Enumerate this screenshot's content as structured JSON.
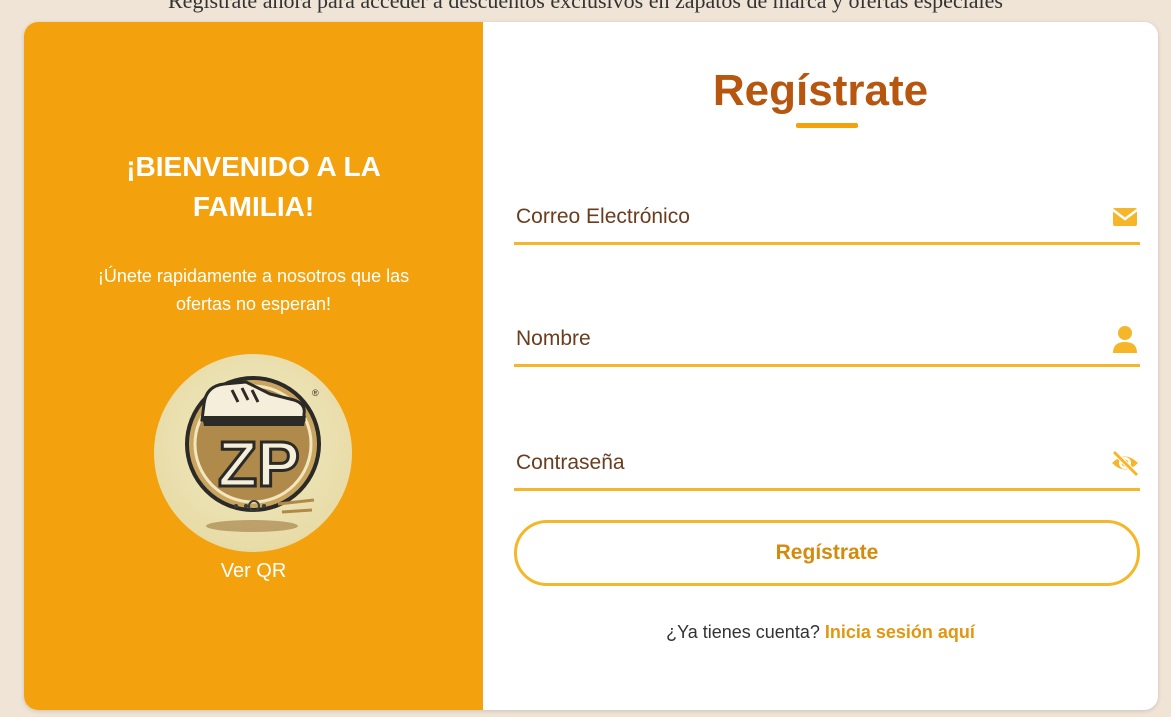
{
  "page": {
    "top_text": "Registrate ahora para acceder a descuentos exclusivos en zapatos de marca y ofertas especiales"
  },
  "welcome": {
    "title_line1": "¡BIENVENIDO A LA",
    "title_line2": "FAMILIA!",
    "subtitle_line1": "¡Únete rapidamente a nosotros que las",
    "subtitle_line2": "ofertas no esperan!",
    "qr_link": "Ver QR",
    "logo_text": "ZP",
    "logo_registered": "®"
  },
  "form": {
    "title": "Regístrate",
    "email_placeholder": "Correo Electrónico",
    "name_placeholder": "Nombre",
    "password_placeholder": "Contraseña",
    "submit_label": "Regístrate",
    "login_prompt": "¿Ya tienes cuenta?",
    "login_link": "Inicia sesión aquí"
  },
  "icons": {
    "email": "envelope-icon",
    "name": "user-icon",
    "password": "eye-slash-icon"
  },
  "colors": {
    "accent": "#f4a10e",
    "title": "#b7560f",
    "field_line": "#f6b62a",
    "button_text": "#d68a0c",
    "link": "#e39610",
    "background": "#efe4d6"
  }
}
